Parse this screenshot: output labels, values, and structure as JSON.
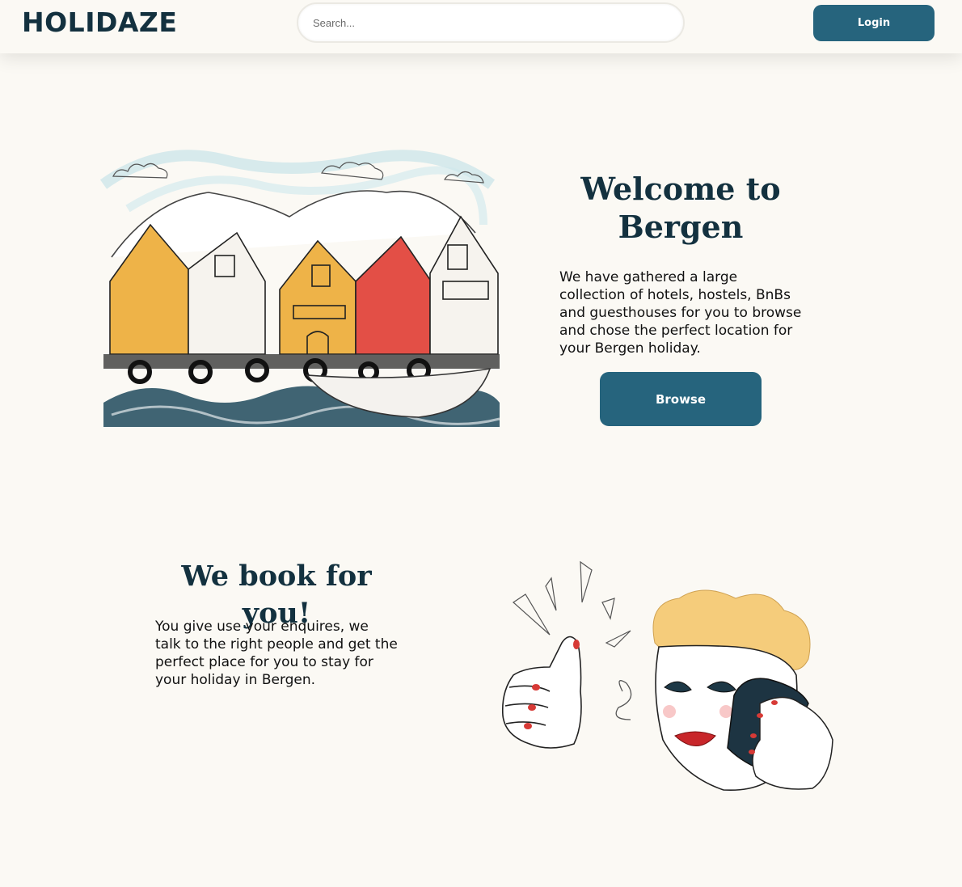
{
  "header": {
    "logo": "HOLIDAZE",
    "search_placeholder": "Search...",
    "login_label": "Login"
  },
  "hero": {
    "title": "Welcome to Bergen",
    "text": "We have gathered a large collection of hotels, hostels, BnBs and guesthouses for you to browse and chose the perfect location for your Bergen holiday.",
    "browse_label": "Browse"
  },
  "book": {
    "title": "We book for you!",
    "text": "You give use your enquires, we talk to the right people and get the perfect place for you to stay for your holiday in Bergen."
  },
  "colors": {
    "background": "#fbf9f4",
    "primary": "#26647d",
    "heading": "#13313f"
  }
}
